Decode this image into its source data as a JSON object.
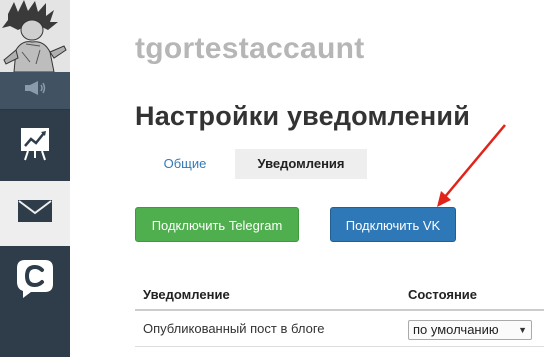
{
  "user": {
    "name": "tgortestaccaunt"
  },
  "page": {
    "title": "Настройки уведомлений"
  },
  "tabs": [
    {
      "label": "Общие",
      "active": false
    },
    {
      "label": "Уведомления",
      "active": true
    }
  ],
  "buttons": {
    "telegram": "Подключить Telegram",
    "vk": "Подключить VK"
  },
  "table": {
    "columns": [
      "Уведомление",
      "Состояние"
    ],
    "rows": [
      {
        "label": "Опубликованный пост в блоге",
        "state": "по умолчанию"
      }
    ]
  },
  "sidebar": {
    "items": [
      {
        "icon": "megaphone-icon"
      },
      {
        "icon": "stats-board-icon"
      },
      {
        "icon": "mail-icon",
        "active": true
      },
      {
        "icon": "comments-logo-icon"
      }
    ]
  },
  "colors": {
    "sidebar": "#2f3d4a",
    "telegram_button": "#4fae4d",
    "vk_button": "#2f78b7",
    "annotation_arrow": "#e2231a"
  }
}
